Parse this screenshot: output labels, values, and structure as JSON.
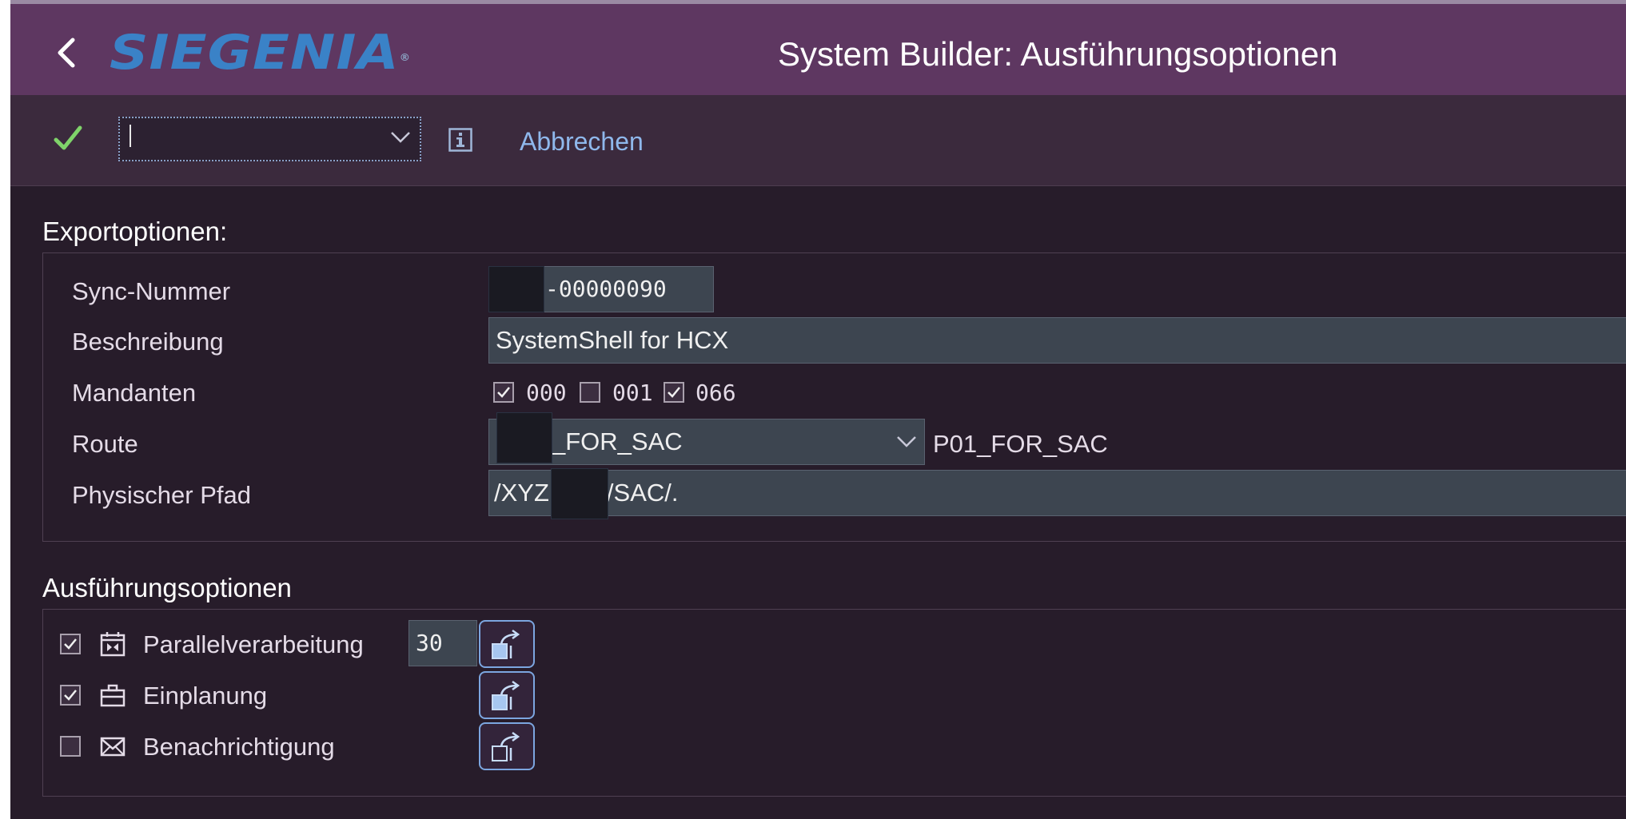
{
  "header": {
    "logo_text": "SIEGENIA",
    "logo_mark": "®",
    "title": "System Builder: Ausführungsoptionen"
  },
  "toolbar": {
    "command_value": "",
    "cancel_label": "Abbrechen"
  },
  "export_options": {
    "section_title": "Exportoptionen:",
    "sync_label": "Sync-Nummer",
    "sync_value": "-00000090",
    "desc_label": "Beschreibung",
    "desc_value": "SystemShell for HCX",
    "clients_label": "Mandanten",
    "clients": [
      {
        "code": "000",
        "checked": true
      },
      {
        "code": "001",
        "checked": false
      },
      {
        "code": "066",
        "checked": true
      }
    ],
    "route_label": "Route",
    "route_value": "_FOR_SAC",
    "route_text": "P01_FOR_SAC",
    "path_label": "Physischer Pfad",
    "path_prefix": "/XYZ",
    "path_suffix": "/SAC/."
  },
  "execution_options": {
    "section_title": "Ausführungsoptionen",
    "options": [
      {
        "label": "Parallelverarbeitung",
        "checked": true,
        "icon": "parallel-processing-icon",
        "value": "30"
      },
      {
        "label": "Einplanung",
        "checked": true,
        "icon": "briefcase-icon"
      },
      {
        "label": "Benachrichtigung",
        "checked": false,
        "icon": "envelope-icon"
      }
    ]
  },
  "colors": {
    "header_bg": "#5e3761",
    "toolbar_bg": "#3b2a3d",
    "content_bg": "#271c2a",
    "link": "#8fb8ec",
    "check_green": "#7fd36a",
    "logo_blue": "#3a82c7"
  }
}
